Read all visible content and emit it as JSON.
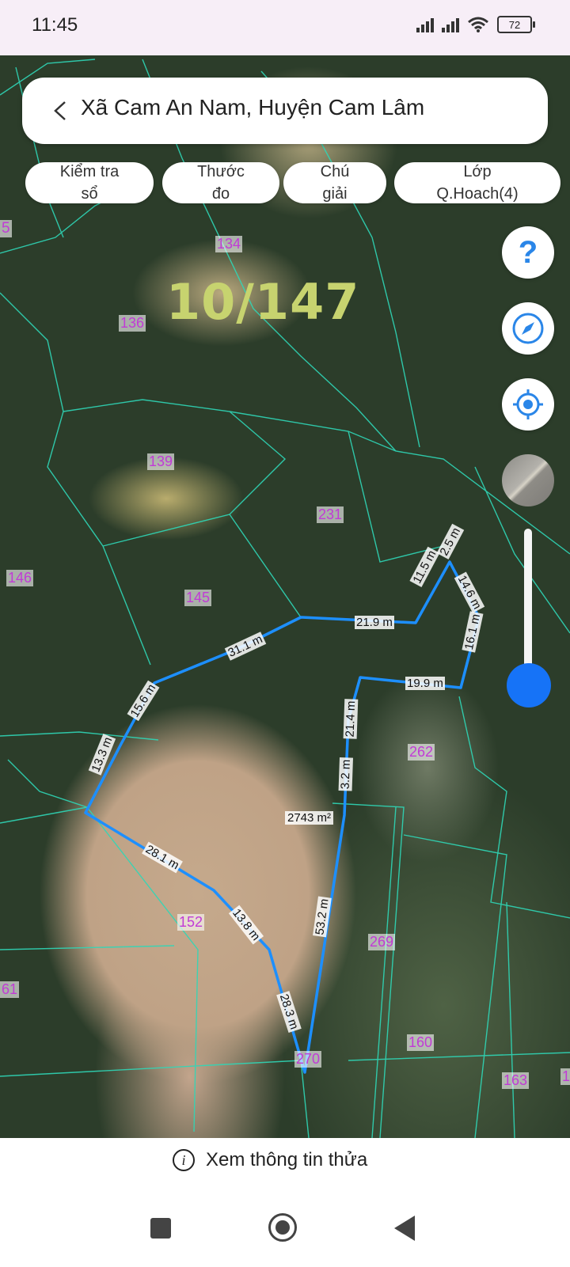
{
  "status_bar": {
    "time": "11:45",
    "battery": "72"
  },
  "header": {
    "title": "Xã Cam An Nam, Huyện Cam Lâm"
  },
  "chips": [
    "Kiểm tra\nsổ",
    "Thước\nđo",
    "Chú\ngiải",
    "Lớp\nQ.Hoach(4)"
  ],
  "map": {
    "parcel_id": "10/147",
    "area_label": "2743 m²",
    "parcel_numbers": [
      "5",
      "134",
      "136",
      "139",
      "231",
      "146",
      "145",
      "262",
      "152",
      "269",
      "61",
      "160",
      "163",
      "270",
      "1"
    ],
    "measurements": [
      "11.5 m",
      "2.5 m",
      "14.6 m",
      "16.1 m",
      "21.9 m",
      "31.1 m",
      "19.9 m",
      "15.6 m",
      "21.4 m",
      "13.3 m",
      "3.2 m",
      "28.1 m",
      "13.8 m",
      "53.2 m",
      "28.3 m"
    ],
    "boundary_color": "#1d8fff",
    "parcel_line_color": "#2fd7b7",
    "parcel_number_color": "#c13bd6"
  },
  "map_controls": {
    "help_icon": "question-icon",
    "compass_icon": "compass-icon",
    "locate_icon": "crosshair-icon",
    "layer_icon": "satellite-layer-icon",
    "slider_accent": "#1673f7"
  },
  "bottom": {
    "info_label": "Xem thông tin thửa"
  }
}
